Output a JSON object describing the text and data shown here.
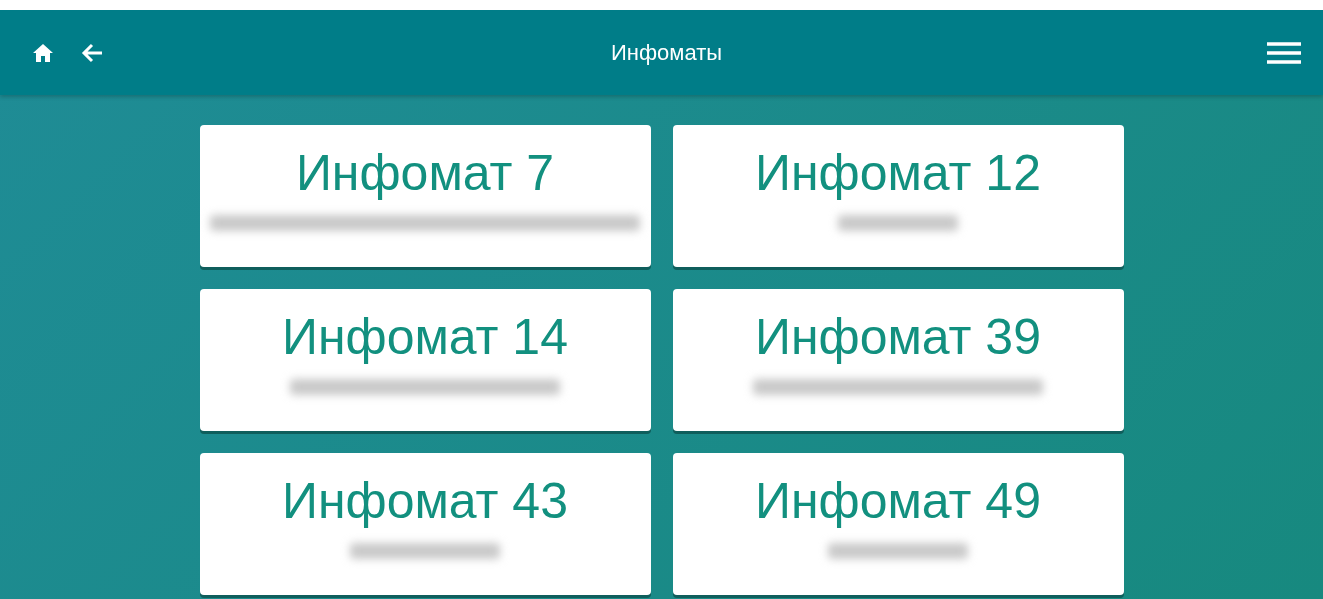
{
  "header": {
    "title": "Инфоматы"
  },
  "kiosks": [
    {
      "name": "Инфомат 7"
    },
    {
      "name": "Инфомат 12"
    },
    {
      "name": "Инфомат 14"
    },
    {
      "name": "Инфомат 39"
    },
    {
      "name": "Инфомат 43"
    },
    {
      "name": "Инфомат 49"
    }
  ]
}
